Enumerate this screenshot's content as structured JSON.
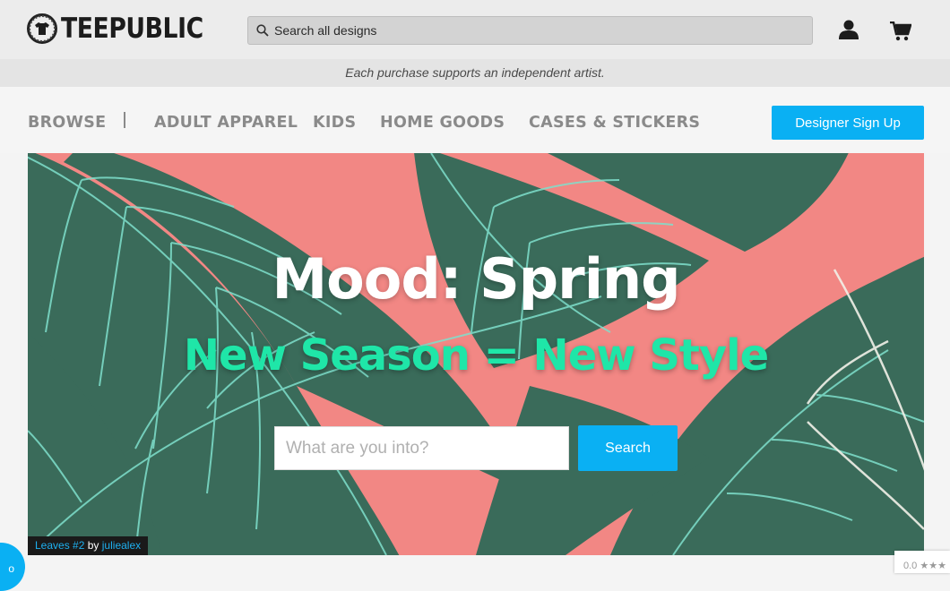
{
  "header": {
    "logo_text": "TEEPUBLIC",
    "search_placeholder": "Search all designs",
    "account_icon": "user-icon",
    "cart_icon": "cart-icon"
  },
  "tagline": "Each purchase supports an independent artist.",
  "nav": {
    "items": [
      "BROWSE",
      "ADULT APPAREL",
      "KIDS",
      "HOME GOODS",
      "CASES & STICKERS"
    ],
    "cta": "Designer Sign Up"
  },
  "hero": {
    "title": "Mood: Spring",
    "subtitle": "New Season = New Style",
    "input_placeholder": "What are you into?",
    "button": "Search",
    "credit": {
      "artwork": "Leaves #2",
      "by": "by",
      "artist": "juliealex"
    }
  },
  "widgets": {
    "chat_label": "o",
    "rating_text": "0.0 ★★★"
  },
  "colors": {
    "accent": "#0ab0f3",
    "hero_background": "#f28784",
    "subtitle_green": "#1fe6a8",
    "leaf_green": "#3a6b5a"
  }
}
